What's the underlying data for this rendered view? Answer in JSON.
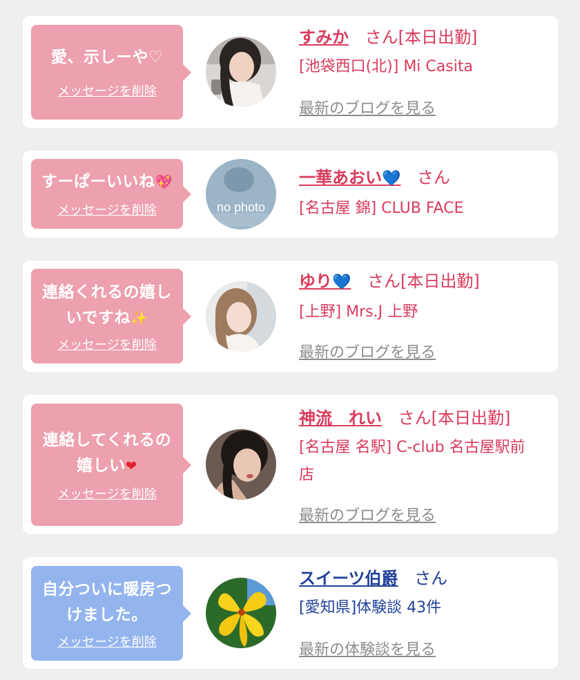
{
  "colors": {
    "pink_bubble": "#eda0ad",
    "blue_bubble": "#94b4ee",
    "name_red": "#d93b5c",
    "name_navy": "#21409a",
    "link_gray": "#8c8c8c"
  },
  "cards": [
    {
      "message_lines": [
        "愛、示しーや♡"
      ],
      "message_emoji": "",
      "delete_label": "メッセージを削除",
      "name": "すみか",
      "name_emoji": "",
      "suffix": "さん[本日出勤]",
      "shop": "[池袋西口(北)] Mi Casita",
      "link": "最新のブログを見る",
      "avatar": "woman-portrait-avatar"
    },
    {
      "message_lines": [
        "すーぱーいいね"
      ],
      "message_emoji": "💖",
      "delete_label": "メッセージを削除",
      "name": "一華あおい",
      "name_emoji": "💙",
      "suffix": "さん",
      "shop": "[名古屋 錦] CLUB FACE",
      "link": "",
      "avatar_text": "no photo",
      "avatar": "no-photo-avatar"
    },
    {
      "message_lines": [
        "連絡くれるの嬉し",
        "いですね"
      ],
      "message_emoji": "✨",
      "delete_label": "メッセージを削除",
      "name": "ゆり",
      "name_emoji": "💙",
      "suffix": "さん[本日出勤]",
      "shop": "[上野] Mrs.J 上野",
      "link": "最新のブログを見る",
      "avatar": "woman-portrait-avatar"
    },
    {
      "message_lines": [
        "連絡してくれるの",
        "嬉しい"
      ],
      "message_emoji": "❤",
      "delete_label": "メッセージを削除",
      "name": "神流　れい",
      "name_emoji": "",
      "suffix": "さん[本日出勤]",
      "shop": "[名古屋 名駅] C-club 名古屋駅前店",
      "link": "最新のブログを見る",
      "avatar": "woman-portrait-avatar"
    },
    {
      "message_lines": [
        "自分ついに暖房つ",
        "けました。"
      ],
      "message_emoji": "",
      "delete_label": "メッセージを削除",
      "name": "スイーツ伯爵",
      "name_emoji": "",
      "suffix": "さん",
      "shop": "[愛知県]体験談 43件",
      "link": "最新の体験談を見る",
      "avatar": "yellow-flower-avatar"
    }
  ]
}
